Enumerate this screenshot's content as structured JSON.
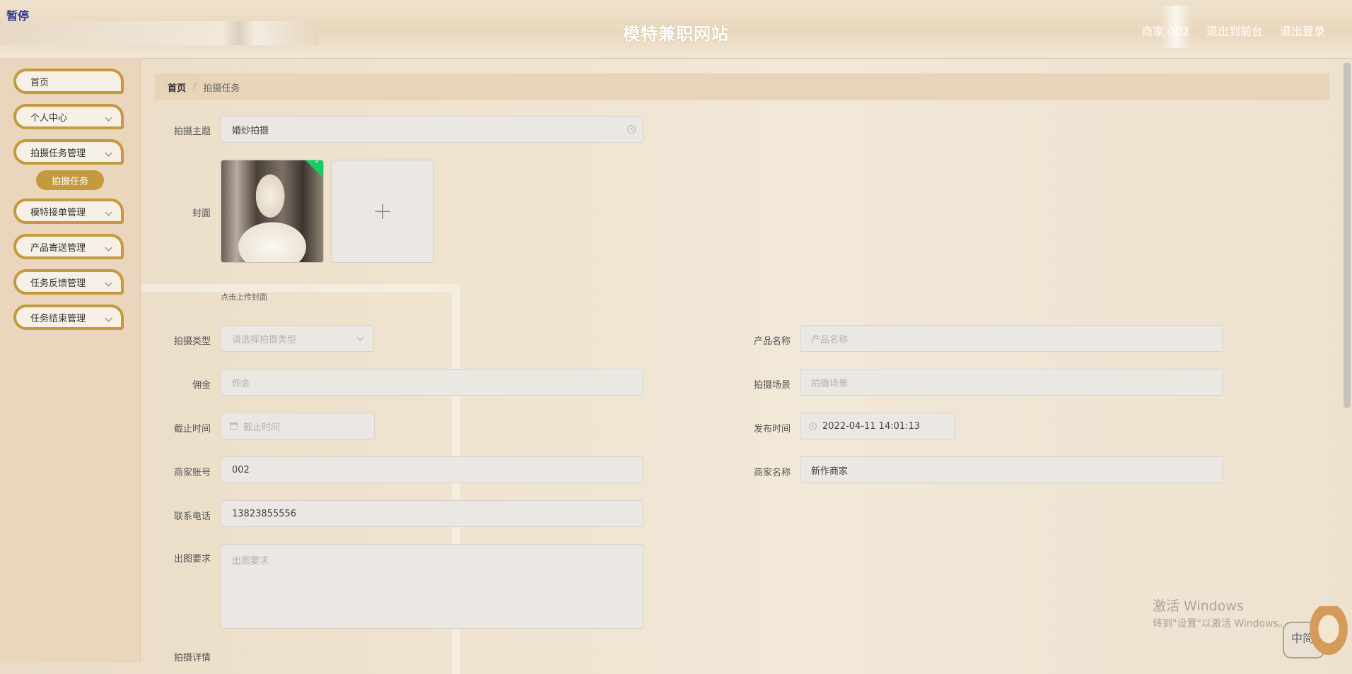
{
  "header": {
    "paused_label": "暂停",
    "title": "模特兼职网站",
    "user": "商家 002",
    "to_front": "退出到前台",
    "logout": "退出登录"
  },
  "sidebar": {
    "items": [
      {
        "label": "首页",
        "has_arrow": false
      },
      {
        "label": "个人中心",
        "has_arrow": true
      },
      {
        "label": "拍摄任务管理",
        "has_arrow": true
      },
      {
        "label": "模特接单管理",
        "has_arrow": true
      },
      {
        "label": "产品寄送管理",
        "has_arrow": true
      },
      {
        "label": "任务反馈管理",
        "has_arrow": true
      },
      {
        "label": "任务结束管理",
        "has_arrow": true
      }
    ],
    "sub_item": "拍摄任务",
    "accent_color": "#c49a3c"
  },
  "breadcrumb": {
    "home": "首页",
    "current": "拍摄任务"
  },
  "form": {
    "subject": {
      "label": "拍摄主题",
      "value": "婚纱拍摄"
    },
    "cover": {
      "label": "封面",
      "hint": "点击上传封面"
    },
    "type": {
      "label": "拍摄类型",
      "placeholder": "请选择拍摄类型"
    },
    "product": {
      "label": "产品名称",
      "placeholder": "产品名称"
    },
    "commission": {
      "label": "佣金",
      "placeholder": "佣金"
    },
    "scene": {
      "label": "拍摄场景",
      "placeholder": "拍摄场景"
    },
    "deadline": {
      "label": "截止时间",
      "placeholder": "截止时间"
    },
    "publish": {
      "label": "发布时间",
      "value": "2022-04-11 14:01:13"
    },
    "account": {
      "label": "商家账号",
      "value": "002"
    },
    "merchant": {
      "label": "商家名称",
      "value": "新作商家"
    },
    "phone": {
      "label": "联系电话",
      "value": "13823855556"
    },
    "requirement": {
      "label": "出图要求",
      "placeholder": "出图要求"
    },
    "detail": {
      "label": "拍摄详情"
    }
  },
  "watermark": {
    "line1": "激活 Windows",
    "line2": "转到\"设置\"以激活 Windows。"
  },
  "ime": "中简"
}
